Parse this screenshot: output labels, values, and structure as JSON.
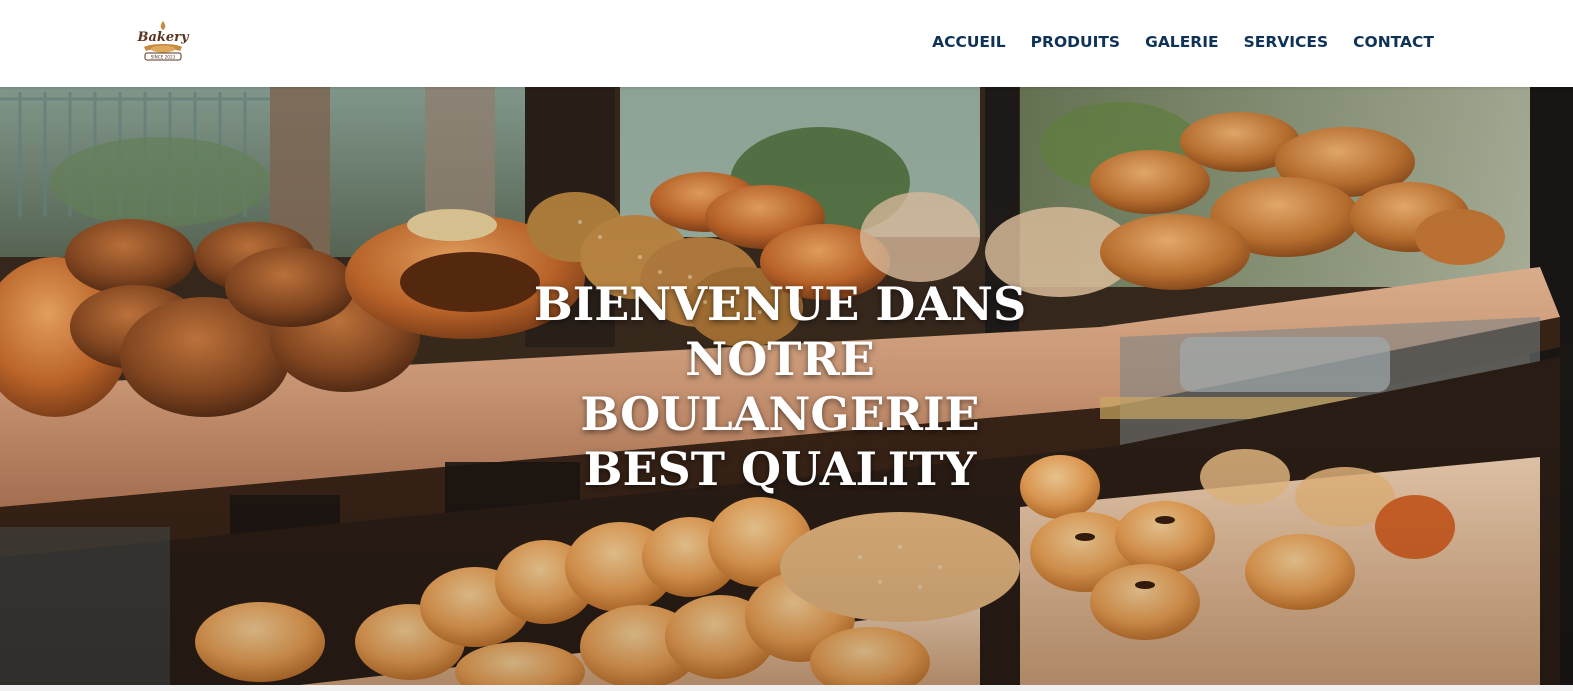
{
  "brand": {
    "logo_text": "Bakery",
    "logo_subtext": "SINCE 2023",
    "colors": {
      "nav_text": "#0f3259",
      "logo_brown": "#5a3520"
    }
  },
  "nav": {
    "items": [
      {
        "label": "ACCUEIL"
      },
      {
        "label": "PRODUITS"
      },
      {
        "label": "GALERIE"
      },
      {
        "label": "SERVICES"
      },
      {
        "label": "CONTACT"
      }
    ]
  },
  "hero": {
    "title": "BIENVENUE DANS NOTRE BOULANGERIE BEST QUALITY",
    "title_color": "#ffffff"
  }
}
